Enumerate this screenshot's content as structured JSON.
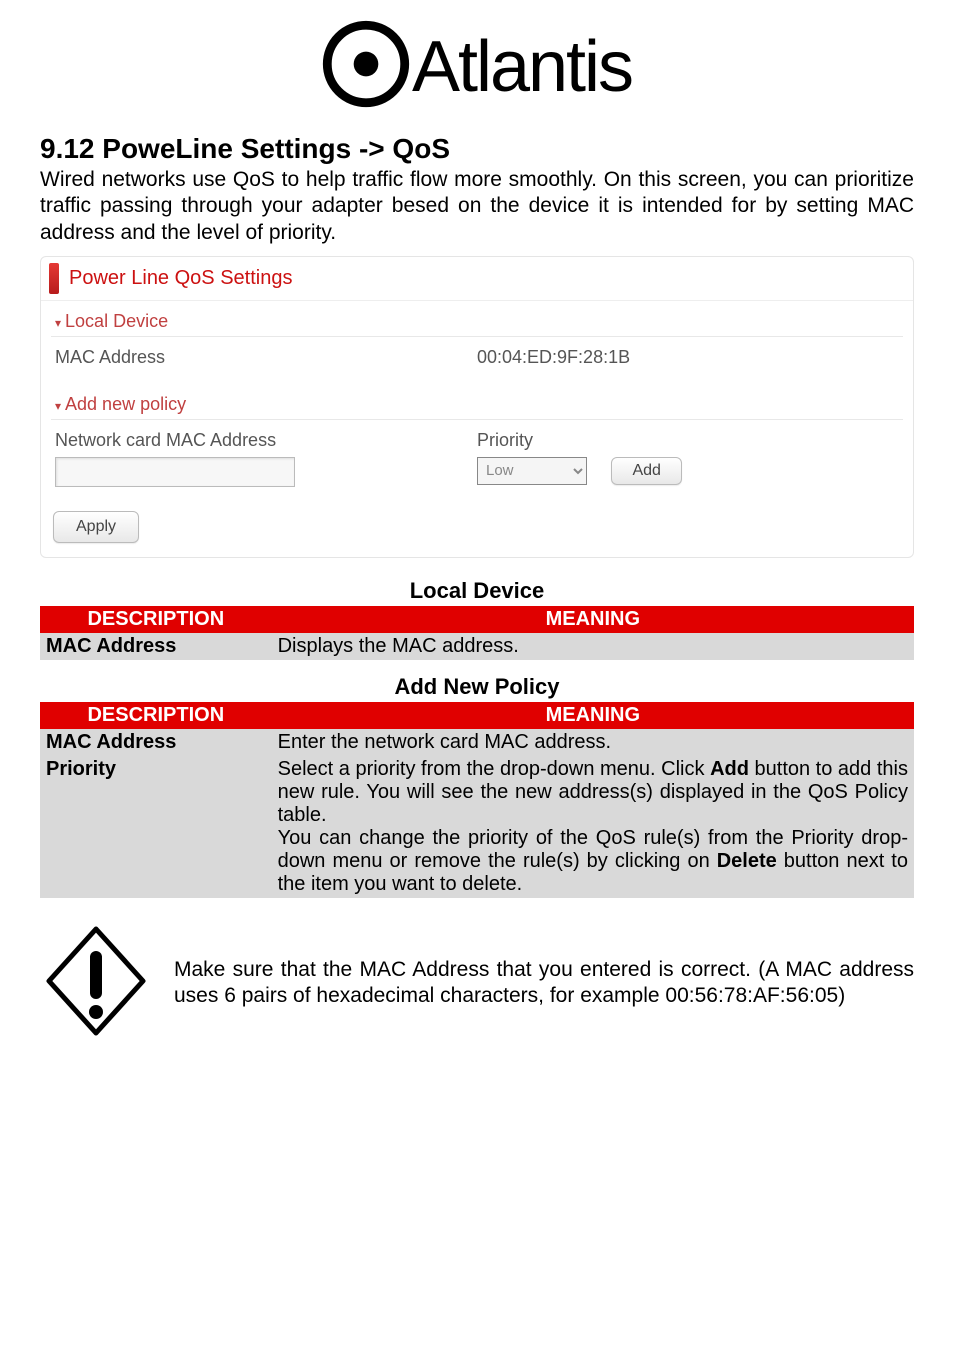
{
  "logo_text": "Atlantis",
  "heading": "9.12 PoweLine Settings -> QoS",
  "intro": "Wired networks use QoS to help traffic flow more smoothly. On this screen, you can prioritize traffic passing through your adapter besed on the device it is intended for by setting MAC address and the level of priority.",
  "panel": {
    "title": "Power Line QoS Settings",
    "local_device_header": "Local Device",
    "mac_label": "MAC Address",
    "mac_value": "00:04:ED:9F:28:1B",
    "add_policy_header": "Add new policy",
    "network_card_label": "Network card MAC Address",
    "priority_label": "Priority",
    "priority_value": "Low",
    "add_button": "Add",
    "apply_button": "Apply"
  },
  "local_device_table": {
    "title": "Local Device",
    "col1": "DESCRIPTION",
    "col2": "MEANING",
    "row1_desc": "MAC Address",
    "row1_mean": "Displays the MAC address."
  },
  "add_policy_table": {
    "title": "Add New Policy",
    "col1": "DESCRIPTION",
    "col2": "MEANING",
    "rows": [
      {
        "desc": "MAC Address",
        "mean_plain": "Enter the network card MAC address."
      },
      {
        "desc": "Priority",
        "mean_pre1": "Select a priority from the drop-down menu. Click ",
        "mean_b1": "Add",
        "mean_mid1": " button to add this new rule. You will see the new address(s) displayed in the QoS Policy table.",
        "mean_br": "",
        "mean_pre2": "You can change the priority of the QoS rule(s) from the Priority drop-down menu or remove the rule(s) by clicking on ",
        "mean_b2": "Delete",
        "mean_post2": " button next to the item you want to delete."
      }
    ]
  },
  "note": "Make sure that the MAC Address that you entered is correct. (A MAC address uses 6 pairs of hexadecimal characters, for example 00:56:78:AF:56:05)"
}
